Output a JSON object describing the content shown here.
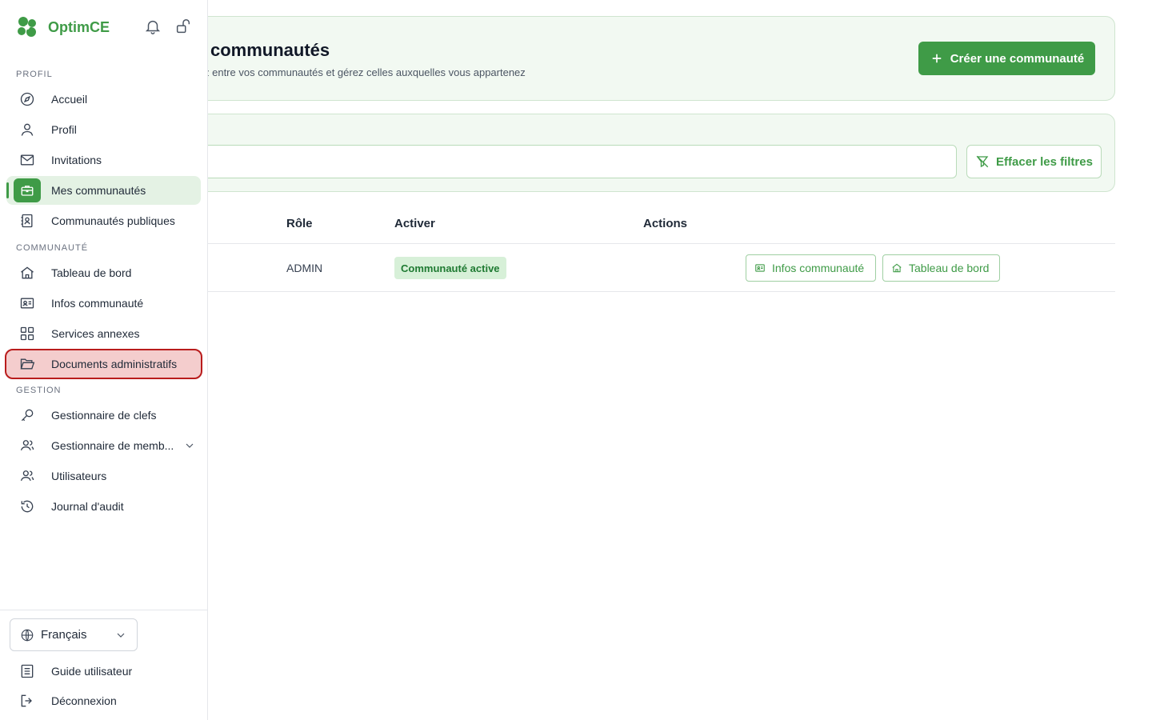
{
  "brand": {
    "name": "OptimCE"
  },
  "sidebar": {
    "sections": [
      {
        "title": "PROFIL"
      },
      {
        "title": "COMMUNAUTÉ"
      },
      {
        "title": "GESTION"
      }
    ],
    "items": [
      {
        "label": "Accueil",
        "icon": "compass-icon"
      },
      {
        "label": "Profil",
        "icon": "user-icon"
      },
      {
        "label": "Invitations",
        "icon": "mail-icon"
      },
      {
        "label": "Mes communautés",
        "icon": "briefcase-icon"
      },
      {
        "label": "Communautés publiques",
        "icon": "contact-book-icon"
      },
      {
        "label": "Tableau de bord",
        "icon": "home-icon"
      },
      {
        "label": "Infos communauté",
        "icon": "id-card-icon"
      },
      {
        "label": "Services annexes",
        "icon": "grid-icon"
      },
      {
        "label": "Documents administratifs",
        "icon": "folder-open-icon"
      },
      {
        "label": "Gestionnaire de clefs",
        "icon": "key-icon"
      },
      {
        "label": "Gestionnaire de memb...",
        "icon": "users-icon"
      },
      {
        "label": "Utilisateurs",
        "icon": "users-icon"
      },
      {
        "label": "Journal d'audit",
        "icon": "history-icon"
      }
    ],
    "language": {
      "selected": "Français"
    },
    "footer": {
      "guide": "Guide utilisateur",
      "logout": "Déconnexion"
    }
  },
  "header": {
    "title": "communautés",
    "subtitle": "z entre vos communautés et gérez celles auxquelles vous appartenez",
    "create_button": "Créer une communauté"
  },
  "filters": {
    "search_value": "",
    "clear_button": "Effacer les filtres"
  },
  "table": {
    "columns": [
      "Rôle",
      "Activer",
      "Actions"
    ],
    "rows": [
      {
        "role": "ADMIN",
        "status": "Communauté active",
        "actions": [
          "Infos communauté",
          "Tableau de bord"
        ]
      }
    ]
  },
  "colors": {
    "accent": "#3f9b47",
    "active_bg": "#e4f2e4",
    "highlight_bg": "#f4cdcd",
    "highlight_border": "#b91c1c"
  }
}
